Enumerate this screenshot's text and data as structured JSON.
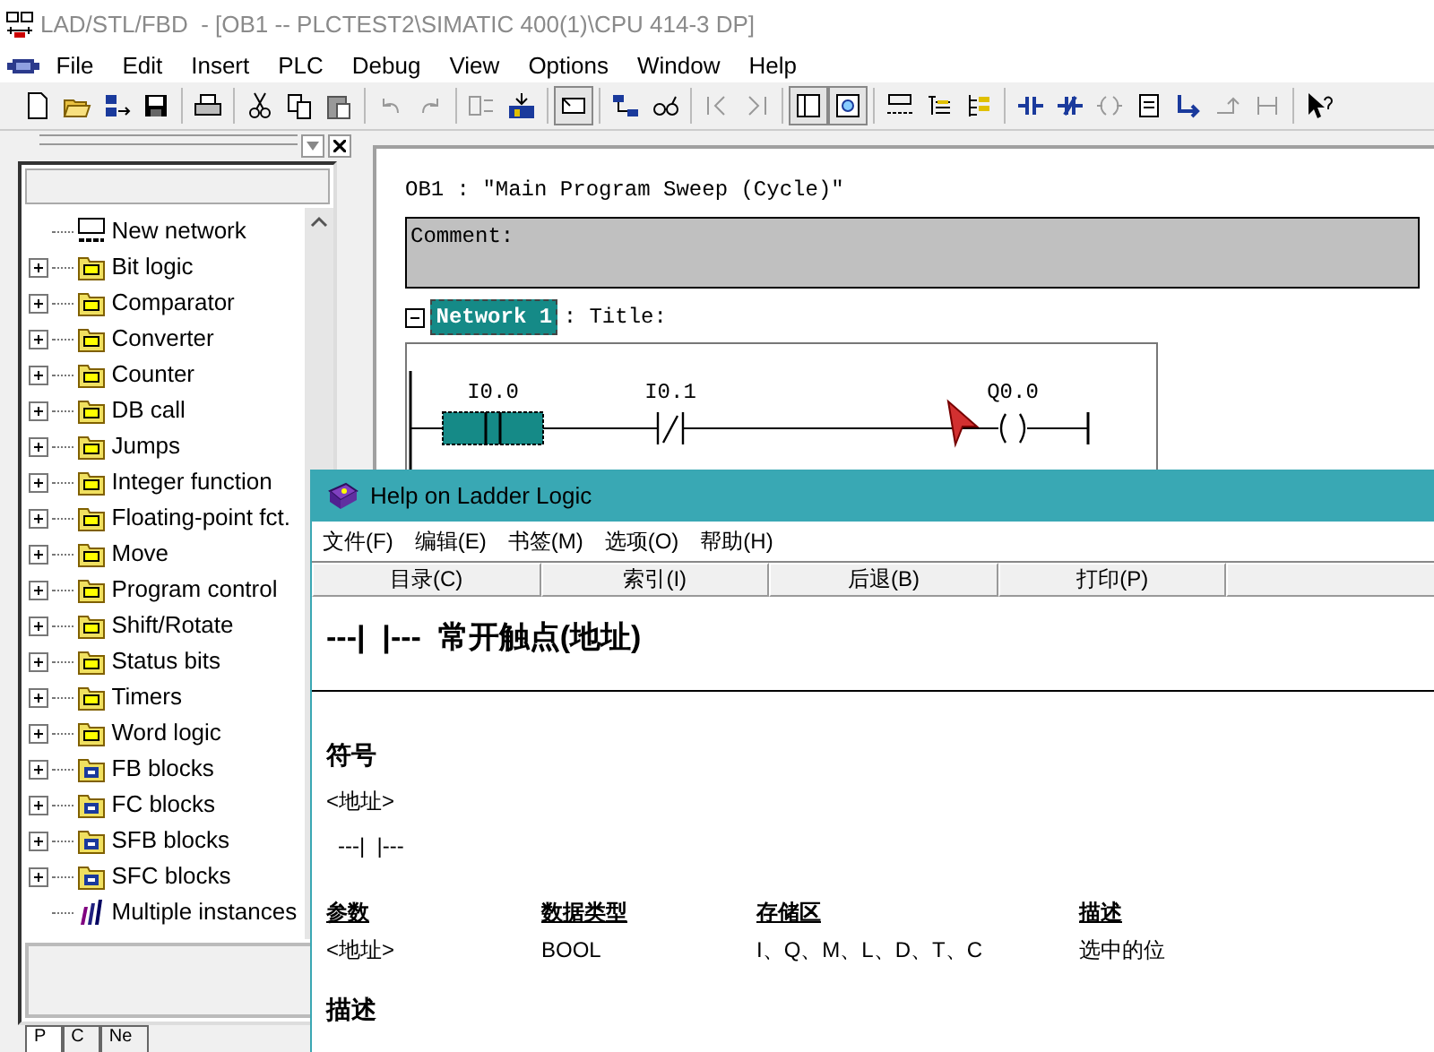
{
  "window": {
    "title": "LAD/STL/FBD  - [OB1 -- PLCTEST2\\SIMATIC 400(1)\\CPU 414-3 DP]"
  },
  "menu": [
    "File",
    "Edit",
    "Insert",
    "PLC",
    "Debug",
    "View",
    "Options",
    "Window",
    "Help"
  ],
  "catalog": {
    "items": [
      {
        "label": "New network",
        "kind": "network"
      },
      {
        "label": "Bit logic",
        "kind": "folder",
        "expanded": false
      },
      {
        "label": "Comparator",
        "kind": "folder",
        "expanded": false
      },
      {
        "label": "Converter",
        "kind": "folder",
        "expanded": false
      },
      {
        "label": "Counter",
        "kind": "folder",
        "expanded": false
      },
      {
        "label": "DB call",
        "kind": "folder",
        "expanded": false
      },
      {
        "label": "Jumps",
        "kind": "folder",
        "expanded": false
      },
      {
        "label": "Integer function",
        "kind": "folder",
        "expanded": false
      },
      {
        "label": "Floating-point fct.",
        "kind": "folder",
        "expanded": false
      },
      {
        "label": "Move",
        "kind": "folder",
        "expanded": false
      },
      {
        "label": "Program control",
        "kind": "folder",
        "expanded": false
      },
      {
        "label": "Shift/Rotate",
        "kind": "folder",
        "expanded": false
      },
      {
        "label": "Status bits",
        "kind": "folder",
        "expanded": false
      },
      {
        "label": "Timers",
        "kind": "folder",
        "expanded": false
      },
      {
        "label": "Word logic",
        "kind": "folder",
        "expanded": false
      },
      {
        "label": "FB blocks",
        "kind": "block",
        "expanded": false
      },
      {
        "label": "FC blocks",
        "kind": "block",
        "expanded": false
      },
      {
        "label": "SFB blocks",
        "kind": "block",
        "expanded": false
      },
      {
        "label": "SFC blocks",
        "kind": "block",
        "expanded": false
      },
      {
        "label": "Multiple instances",
        "kind": "instances"
      }
    ],
    "tabs": [
      {
        "label": "P",
        "selected": true
      },
      {
        "label": "C",
        "selected": false
      },
      {
        "label": "Ne",
        "selected": false
      }
    ]
  },
  "editor": {
    "block_header": "OB1 :  ″Main Program Sweep (Cycle)″",
    "comment_label": "Comment:",
    "network": {
      "label": "Network 1",
      "selected": true,
      "expanded": true,
      "title": ": Title:",
      "elements": [
        {
          "kind": "no_contact",
          "address": "I0.0",
          "selected": true
        },
        {
          "kind": "nc_contact",
          "address": "I0.1",
          "selected": false
        },
        {
          "kind": "coil",
          "address": "Q0.0",
          "selected": false
        }
      ]
    }
  },
  "help_window": {
    "title": "Help on Ladder Logic",
    "menu": [
      "文件(F)",
      "编辑(E)",
      "书签(M)",
      "选项(O)",
      "帮助(H)"
    ],
    "buttons": [
      "目录(C)",
      "索引(I)",
      "后退(B)",
      "打印(P)"
    ],
    "heading": "---|  |---  常开触点(地址)",
    "symbol_heading": "符号",
    "symbol_address": "<地址>",
    "symbol": "---|  |---",
    "table": {
      "columns": [
        "参数",
        "数据类型",
        "存储区",
        "描述"
      ],
      "rows": [
        [
          "<地址>",
          "BOOL",
          "I、Q、M、L、D、T、C",
          "选中的位"
        ]
      ]
    },
    "description_heading": "描述"
  }
}
